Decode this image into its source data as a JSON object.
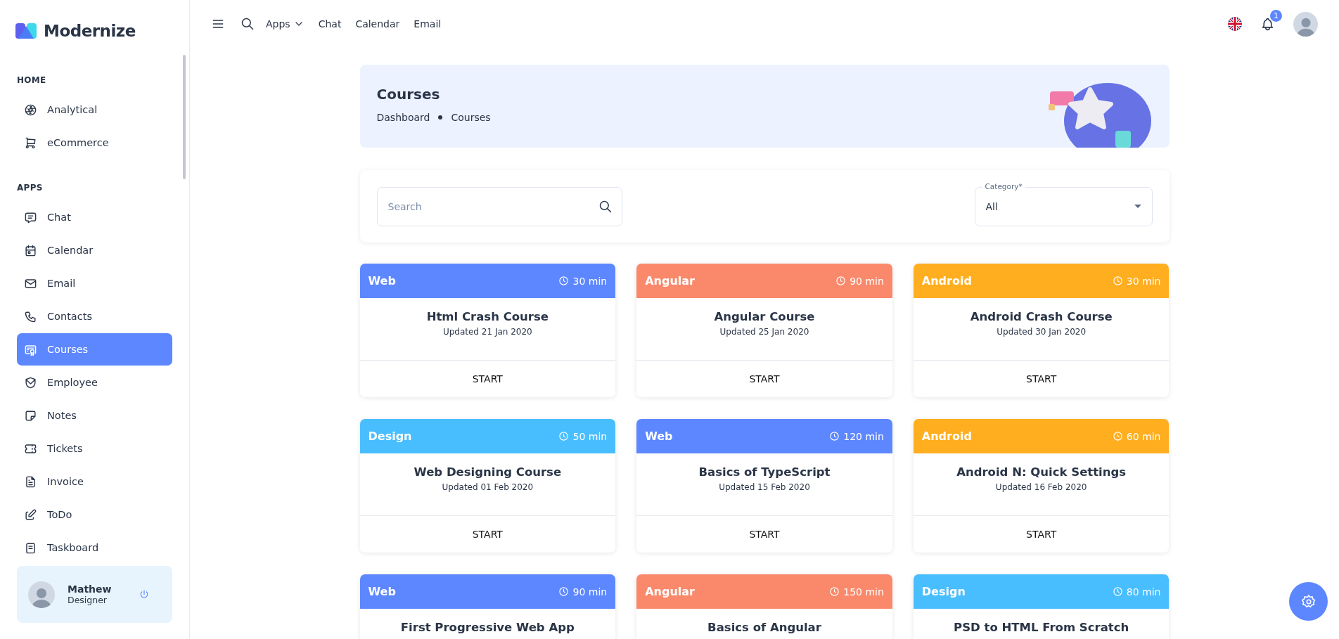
{
  "brand": {
    "name": "Modernize"
  },
  "sidebar": {
    "sections": [
      {
        "title": "HOME",
        "items": [
          {
            "label": "Analytical",
            "selected": false
          },
          {
            "label": "eCommerce",
            "selected": false
          }
        ]
      },
      {
        "title": "APPS",
        "items": [
          {
            "label": "Chat",
            "selected": false
          },
          {
            "label": "Calendar",
            "selected": false
          },
          {
            "label": "Email",
            "selected": false
          },
          {
            "label": "Contacts",
            "selected": false
          },
          {
            "label": "Courses",
            "selected": true
          },
          {
            "label": "Employee",
            "selected": false
          },
          {
            "label": "Notes",
            "selected": false
          },
          {
            "label": "Tickets",
            "selected": false
          },
          {
            "label": "Invoice",
            "selected": false
          },
          {
            "label": "ToDo",
            "selected": false
          },
          {
            "label": "Taskboard",
            "selected": false
          }
        ]
      }
    ],
    "user": {
      "name": "Mathew",
      "role": "Designer"
    }
  },
  "topbar": {
    "links": [
      {
        "label": "Apps",
        "dropdown": true
      },
      {
        "label": "Chat",
        "dropdown": false
      },
      {
        "label": "Calendar",
        "dropdown": false
      },
      {
        "label": "Email",
        "dropdown": false
      }
    ],
    "notification_count": "1"
  },
  "page_header": {
    "title": "Courses",
    "breadcrumb": [
      "Dashboard",
      "Courses"
    ]
  },
  "filters": {
    "search": {
      "placeholder": "Search"
    },
    "category": {
      "label": "Category*",
      "value": "All"
    }
  },
  "courses": [
    {
      "category": "Web",
      "color": "#5d87ff",
      "duration": "30 min",
      "title": "Html Crash Course",
      "updated": "Updated 21 Jan 2020",
      "action": "START"
    },
    {
      "category": "Angular",
      "color": "#fa896b",
      "duration": "90 min",
      "title": "Angular Course",
      "updated": "Updated 25 Jan 2020",
      "action": "START"
    },
    {
      "category": "Android",
      "color": "#ffae1f",
      "duration": "30 min",
      "title": "Android Crash Course",
      "updated": "Updated 30 Jan 2020",
      "action": "START"
    },
    {
      "category": "Design",
      "color": "#49beff",
      "duration": "50 min",
      "title": "Web Designing Course",
      "updated": "Updated 01 Feb 2020",
      "action": "START"
    },
    {
      "category": "Web",
      "color": "#5d87ff",
      "duration": "120 min",
      "title": "Basics of TypeScript",
      "updated": "Updated 15 Feb 2020",
      "action": "START"
    },
    {
      "category": "Android",
      "color": "#ffae1f",
      "duration": "60 min",
      "title": "Android N: Quick Settings",
      "updated": "Updated 16 Feb 2020",
      "action": "START"
    },
    {
      "category": "Web",
      "color": "#5d87ff",
      "duration": "90 min",
      "title": "First Progressive Web App"
    },
    {
      "category": "Angular",
      "color": "#fa896b",
      "duration": "150 min",
      "title": "Basics of Angular"
    },
    {
      "category": "Design",
      "color": "#49beff",
      "duration": "80 min",
      "title": "PSD to HTML From Scratch"
    }
  ]
}
